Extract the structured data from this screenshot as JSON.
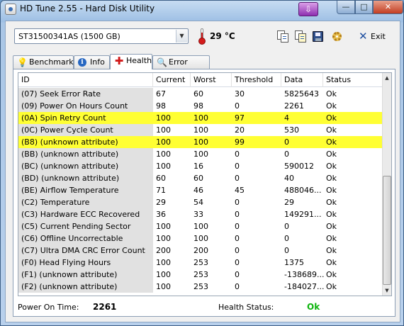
{
  "window": {
    "title": "HD Tune 2.55 - Hard Disk Utility",
    "minimize_glyph": "—",
    "maximize_glyph": "□",
    "close_glyph": "✕",
    "quick_glyph": "⇩"
  },
  "toolbar": {
    "drive": "ST31500341AS (1500 GB)",
    "temperature": "29 °C",
    "exit_label": "Exit"
  },
  "tabs": [
    {
      "label": "Benchmark",
      "icon": "lightbulb-icon"
    },
    {
      "label": "Info",
      "icon": "info-icon"
    },
    {
      "label": "Health",
      "icon": "health-cross-icon",
      "active": true
    },
    {
      "label": "Error Scan",
      "icon": "magnifier-icon"
    }
  ],
  "table": {
    "columns": [
      "ID",
      "Current",
      "Worst",
      "Threshold",
      "Data",
      "Status"
    ],
    "rows": [
      {
        "id": "(07) Seek Error Rate",
        "current": "67",
        "worst": "60",
        "threshold": "30",
        "data": "5825643",
        "status": "Ok",
        "highlight": false
      },
      {
        "id": "(09) Power On Hours Count",
        "current": "98",
        "worst": "98",
        "threshold": "0",
        "data": "2261",
        "status": "Ok",
        "highlight": false
      },
      {
        "id": "(0A) Spin Retry Count",
        "current": "100",
        "worst": "100",
        "threshold": "97",
        "data": "4",
        "status": "Ok",
        "highlight": true
      },
      {
        "id": "(0C) Power Cycle Count",
        "current": "100",
        "worst": "100",
        "threshold": "20",
        "data": "530",
        "status": "Ok",
        "highlight": false
      },
      {
        "id": "(B8) (unknown attribute)",
        "current": "100",
        "worst": "100",
        "threshold": "99",
        "data": "0",
        "status": "Ok",
        "highlight": true
      },
      {
        "id": "(BB) (unknown attribute)",
        "current": "100",
        "worst": "100",
        "threshold": "0",
        "data": "0",
        "status": "Ok",
        "highlight": false
      },
      {
        "id": "(BC) (unknown attribute)",
        "current": "100",
        "worst": "16",
        "threshold": "0",
        "data": "590012",
        "status": "Ok",
        "highlight": false
      },
      {
        "id": "(BD) (unknown attribute)",
        "current": "60",
        "worst": "60",
        "threshold": "0",
        "data": "40",
        "status": "Ok",
        "highlight": false
      },
      {
        "id": "(BE) Airflow Temperature",
        "current": "71",
        "worst": "46",
        "threshold": "45",
        "data": "488046...",
        "status": "Ok",
        "highlight": false
      },
      {
        "id": "(C2) Temperature",
        "current": "29",
        "worst": "54",
        "threshold": "0",
        "data": "29",
        "status": "Ok",
        "highlight": false
      },
      {
        "id": "(C3) Hardware ECC Recovered",
        "current": "36",
        "worst": "33",
        "threshold": "0",
        "data": "149291...",
        "status": "Ok",
        "highlight": false
      },
      {
        "id": "(C5) Current Pending Sector",
        "current": "100",
        "worst": "100",
        "threshold": "0",
        "data": "0",
        "status": "Ok",
        "highlight": false
      },
      {
        "id": "(C6) Offline Uncorrectable",
        "current": "100",
        "worst": "100",
        "threshold": "0",
        "data": "0",
        "status": "Ok",
        "highlight": false
      },
      {
        "id": "(C7) Ultra DMA CRC Error Count",
        "current": "200",
        "worst": "200",
        "threshold": "0",
        "data": "0",
        "status": "Ok",
        "highlight": false
      },
      {
        "id": "(F0) Head Flying Hours",
        "current": "100",
        "worst": "253",
        "threshold": "0",
        "data": "1375",
        "status": "Ok",
        "highlight": false
      },
      {
        "id": "(F1) (unknown attribute)",
        "current": "100",
        "worst": "253",
        "threshold": "0",
        "data": "-138689...",
        "status": "Ok",
        "highlight": false
      },
      {
        "id": "(F2) (unknown attribute)",
        "current": "100",
        "worst": "253",
        "threshold": "0",
        "data": "-184027...",
        "status": "Ok",
        "highlight": false
      }
    ]
  },
  "footer": {
    "power_on_label": "Power On Time:",
    "power_on_value": "2261",
    "health_label": "Health Status:",
    "health_value": "Ok"
  },
  "colors": {
    "highlight_row": "#ffff33",
    "health_ok": "#0fb50f"
  }
}
